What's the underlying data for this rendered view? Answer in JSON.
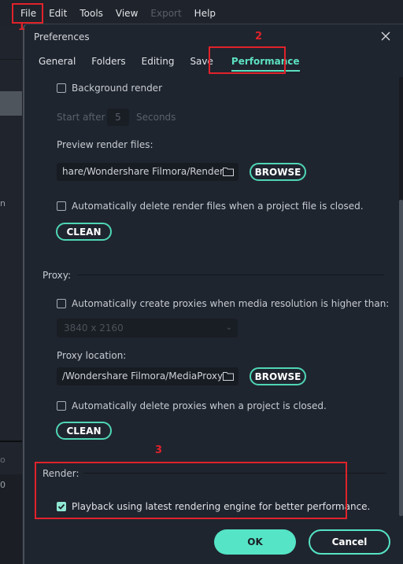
{
  "menubar": {
    "items": [
      {
        "label": "File",
        "disabled": false
      },
      {
        "label": "Edit",
        "disabled": false
      },
      {
        "label": "Tools",
        "disabled": false
      },
      {
        "label": "View",
        "disabled": false
      },
      {
        "label": "Export",
        "disabled": true
      },
      {
        "label": "Help",
        "disabled": false
      }
    ]
  },
  "background": {
    "glyph_1": "n",
    "glyph_2": "o",
    "glyph_3": "0"
  },
  "dialog": {
    "title": "Preferences",
    "close_icon": "×",
    "tabs": [
      {
        "label": "General",
        "active": false
      },
      {
        "label": "Folders",
        "active": false
      },
      {
        "label": "Editing",
        "active": false
      },
      {
        "label": "Save",
        "active": false
      },
      {
        "label": "Performance",
        "active": true
      }
    ],
    "preview_render": {
      "background_render_label": "Background render",
      "background_render_checked": false,
      "start_after_label": "Start after",
      "start_after_value": "5",
      "seconds_label": "Seconds",
      "files_label": "Preview render files:",
      "path_value": "hare/Wondershare Filmora/Render",
      "browse_label": "BROWSE",
      "auto_delete_label": "Automatically delete render files when a project file is closed.",
      "auto_delete_checked": false,
      "clean_label": "CLEAN"
    },
    "proxy": {
      "section_title": "Proxy:",
      "auto_create_label": "Automatically create proxies when media resolution is higher than:",
      "auto_create_checked": false,
      "resolution_selected": "3840 x 2160",
      "location_label": "Proxy location:",
      "path_value": "/Wondershare Filmora/MediaProxy",
      "browse_label": "BROWSE",
      "auto_delete_label": "Automatically delete proxies when a project is closed.",
      "auto_delete_checked": false,
      "clean_label": "CLEAN"
    },
    "render": {
      "section_title": "Render:",
      "playback_label": "Playback using latest rendering engine for better performance.",
      "playback_checked": true
    },
    "ok_label": "OK",
    "cancel_label": "Cancel"
  },
  "annotations": {
    "marker_1": "1",
    "marker_2": "2",
    "marker_3": "3",
    "color": "#e0222a"
  },
  "colors": {
    "accent": "#55e4c6",
    "dialog_bg": "#1f252f",
    "field_bg": "#171b22"
  }
}
